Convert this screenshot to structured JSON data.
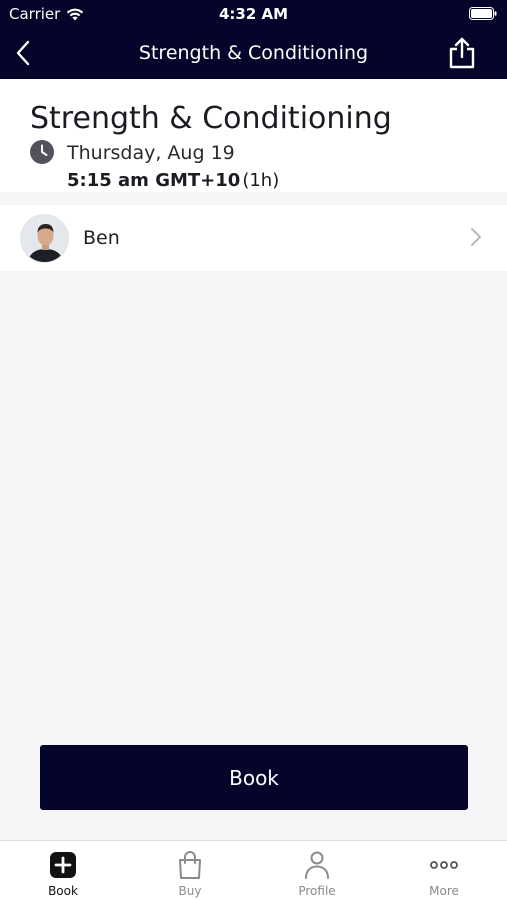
{
  "status_bar": {
    "carrier": "Carrier",
    "time": "4:32 AM"
  },
  "nav": {
    "title": "Strength & Conditioning",
    "back_icon": "chevron-left-icon",
    "share_icon": "share-icon"
  },
  "class_info": {
    "title": "Strength & Conditioning",
    "date": "Thursday, Aug 19",
    "time": "5:15 am GMT+10",
    "duration": "(1h)"
  },
  "instructor": {
    "name": "Ben"
  },
  "book_button": {
    "label": "Book"
  },
  "tab_bar": {
    "tabs": [
      {
        "label": "Book",
        "icon": "plus-square-icon",
        "active": true
      },
      {
        "label": "Buy",
        "icon": "shopping-bag-icon",
        "active": false
      },
      {
        "label": "Profile",
        "icon": "person-icon",
        "active": false
      },
      {
        "label": "More",
        "icon": "more-dots-icon",
        "active": false
      }
    ]
  },
  "colors": {
    "primary": "#05052b",
    "background": "#f6f6f8",
    "card": "#ffffff",
    "inactive_tab": "#8a8a90"
  }
}
